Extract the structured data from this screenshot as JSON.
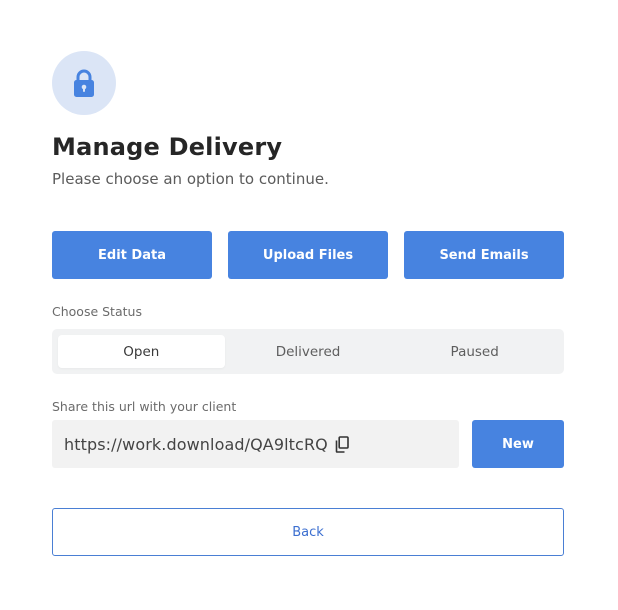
{
  "colors": {
    "accent": "#4783e0",
    "badge_background": "#dbe5f6",
    "segmented_background": "#f1f2f3",
    "url_background": "#f2f2f2"
  },
  "header": {
    "icon": "lock-icon",
    "title": "Manage Delivery",
    "subtitle": "Please choose an option to continue."
  },
  "actions": {
    "buttons": [
      {
        "label": "Edit Data"
      },
      {
        "label": "Upload Files"
      },
      {
        "label": "Send Emails"
      }
    ]
  },
  "status": {
    "label": "Choose Status",
    "selected": "Open",
    "options": [
      {
        "label": "Open"
      },
      {
        "label": "Delivered"
      },
      {
        "label": "Paused"
      }
    ]
  },
  "share": {
    "label": "Share this url with your client",
    "url": "https://work.download/QA9ltcRQ",
    "copy_icon": "copy-icon",
    "new_label": "New"
  },
  "footer": {
    "back_label": "Back"
  }
}
